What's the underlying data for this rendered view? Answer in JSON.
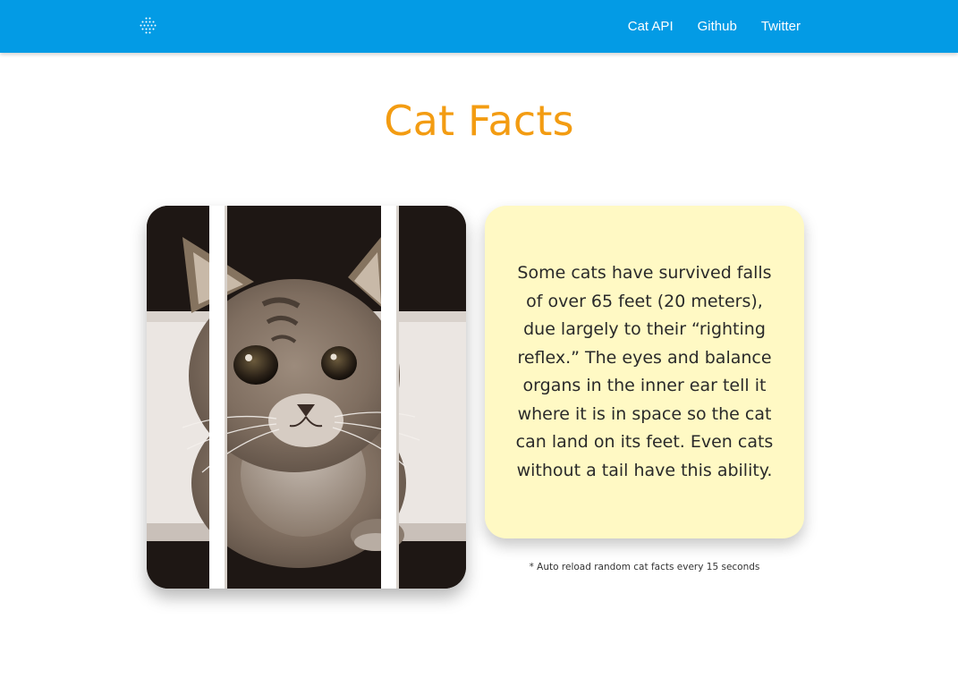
{
  "navbar": {
    "background_color": "#039be5",
    "logo_icon": "dot-grid-logo-icon",
    "links": [
      {
        "label": "Cat API"
      },
      {
        "label": "Github"
      },
      {
        "label": "Twitter"
      }
    ]
  },
  "main": {
    "title": "Cat Facts",
    "title_color": "#f39c12",
    "image": {
      "subject": "tabby-cat-photo"
    },
    "fact": {
      "text": "Some cats have survived falls of over 65 feet (20 meters), due largely to their “righting reflex.” The eyes and balance organs in the inner ear tell it where it is in space so the cat can land on its feet. Even cats without a tail have this ability.",
      "background_color": "#fff9c4"
    },
    "reload_note": "* Auto reload random cat facts every 15 seconds"
  }
}
